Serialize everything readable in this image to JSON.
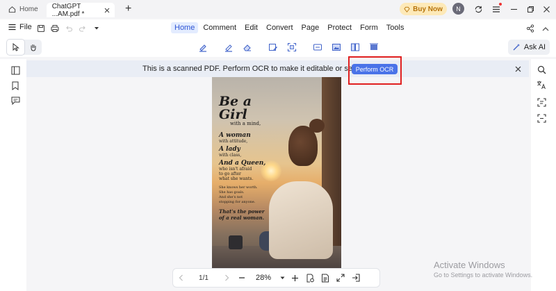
{
  "tabbar": {
    "home_label": "Home",
    "doc_tab_label": "ChatGPT ...AM.pdf *",
    "buy_now_label": "Buy Now",
    "avatar_initial": "N"
  },
  "menubar": {
    "file_label": "File",
    "items": [
      "Home",
      "Comment",
      "Edit",
      "Convert",
      "Page",
      "Protect",
      "Form",
      "Tools"
    ],
    "active_item": "Home"
  },
  "toolbar": {
    "ask_ai_label": "Ask AI"
  },
  "notice": {
    "message": "This is a scanned PDF. Perform OCR to make it editable or searchable.",
    "ocr_button_label": "Perform OCR"
  },
  "document": {
    "poem": {
      "title": "Be a Girl",
      "title_sub": "with a mind,",
      "line1_big": "A woman",
      "line1_sub": "with attitude,",
      "line2_big": "A lady",
      "line2_sub": "with class,",
      "line3_big": "And a Queen,",
      "line3_sub1": "who isn't afraid",
      "line3_sub2": "to go after",
      "line3_sub3": "what she wants.",
      "verse1": "She knows her worth.",
      "verse2": "She has goals.",
      "verse3": "And she's not",
      "verse4": "stopping for anyone.",
      "closing1": "That's the power",
      "closing2": "of a real woman."
    }
  },
  "pagenav": {
    "page_indicator": "1/1",
    "zoom_level": "28%"
  },
  "watermark": {
    "line1": "Activate Windows",
    "line2": "Go to Settings to activate Windows."
  },
  "colors": {
    "accent": "#4a73e8",
    "highlight_box": "#e02020",
    "buy_now_bg": "#fde9b8"
  }
}
